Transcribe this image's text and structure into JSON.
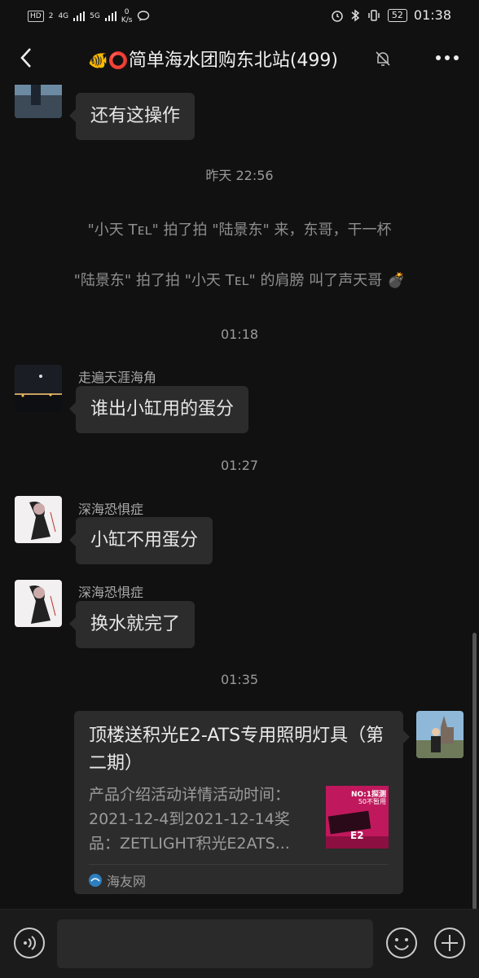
{
  "status_bar": {
    "hd": "HD",
    "sim1": "2",
    "net1": "4G",
    "net2": "5G",
    "speed_value": "0",
    "speed_unit": "K/s",
    "battery": "52",
    "time": "01:38"
  },
  "header": {
    "emoji_fish": "🐠",
    "emoji_circle": "⭕",
    "title": "简单海水团购东北站(499)"
  },
  "messages": {
    "m0": {
      "text": "还有这操作"
    },
    "ts1": "昨天 22:56",
    "sys1": "\"小天 Tᴇʟ\" 拍了拍 \"陆景东\" 来，东哥，干一杯",
    "sys2": "\"陆景东\" 拍了拍 \"小天 Tᴇʟ\" 的肩膀 叫了声天哥",
    "sys2_emoji": "💣",
    "ts2": "01:18",
    "m1": {
      "sender": "走遍天涯海角",
      "text": "谁出小缸用的蛋分"
    },
    "ts3": "01:27",
    "m2": {
      "sender": "深海恐惧症",
      "text": "小缸不用蛋分"
    },
    "m3": {
      "sender": "深海恐惧症",
      "text": "换水就完了"
    },
    "ts4": "01:35"
  },
  "link_card": {
    "title": "顶楼送积光E2-ATS专用照明灯具（第二期）",
    "description": "产品介绍活动详情活动时间：2021-12-4到2021-12-14奖品：ZETLIGHT积光E2ATS...",
    "thumb_line1": "NO:1探测",
    "thumb_line2": "50不暂用",
    "thumb_label": "E2",
    "source": "海友网"
  },
  "colors": {
    "background": "#111111",
    "bubble": "#2c2c2c",
    "text": "#e6e6e6",
    "muted": "#9a9a9a"
  }
}
